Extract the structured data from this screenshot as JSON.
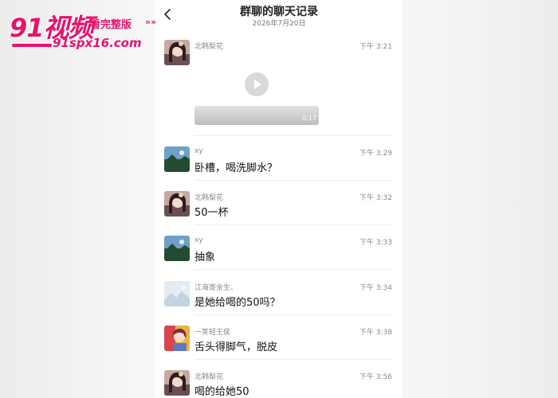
{
  "watermark": {
    "brand": "91视频",
    "tagline": "看完整版",
    "arrows": "»»",
    "url": "91spx16.com"
  },
  "header": {
    "title": "群聊的聊天记录",
    "date": "2026年7月20日"
  },
  "messages": [
    {
      "name": "北韩梨花",
      "time": "下午 3:21",
      "type": "video",
      "duration": "0:17",
      "avatar": "anime-girl"
    },
    {
      "name": "xy",
      "time": "下午 3:29",
      "text": "卧槽，喝洗脚水？",
      "avatar": "landscape"
    },
    {
      "name": "北韩梨花",
      "time": "下午 3:32",
      "text": "50一杯",
      "avatar": "anime-girl"
    },
    {
      "name": "xy",
      "time": "下午 3:33",
      "text": "抽象",
      "avatar": "landscape"
    },
    {
      "name": "江海寄余生、",
      "time": "下午 3:34",
      "text": "是她给喝的50吗？",
      "avatar": "pale-landscape"
    },
    {
      "name": "一笑轻王侯",
      "time": "下午 3:38",
      "text": "舌头得脚气，脱皮",
      "avatar": "colorful-anime"
    },
    {
      "name": "北韩梨花",
      "time": "下午 3:56",
      "text": "喝的给她50",
      "avatar": "anime-girl"
    }
  ]
}
